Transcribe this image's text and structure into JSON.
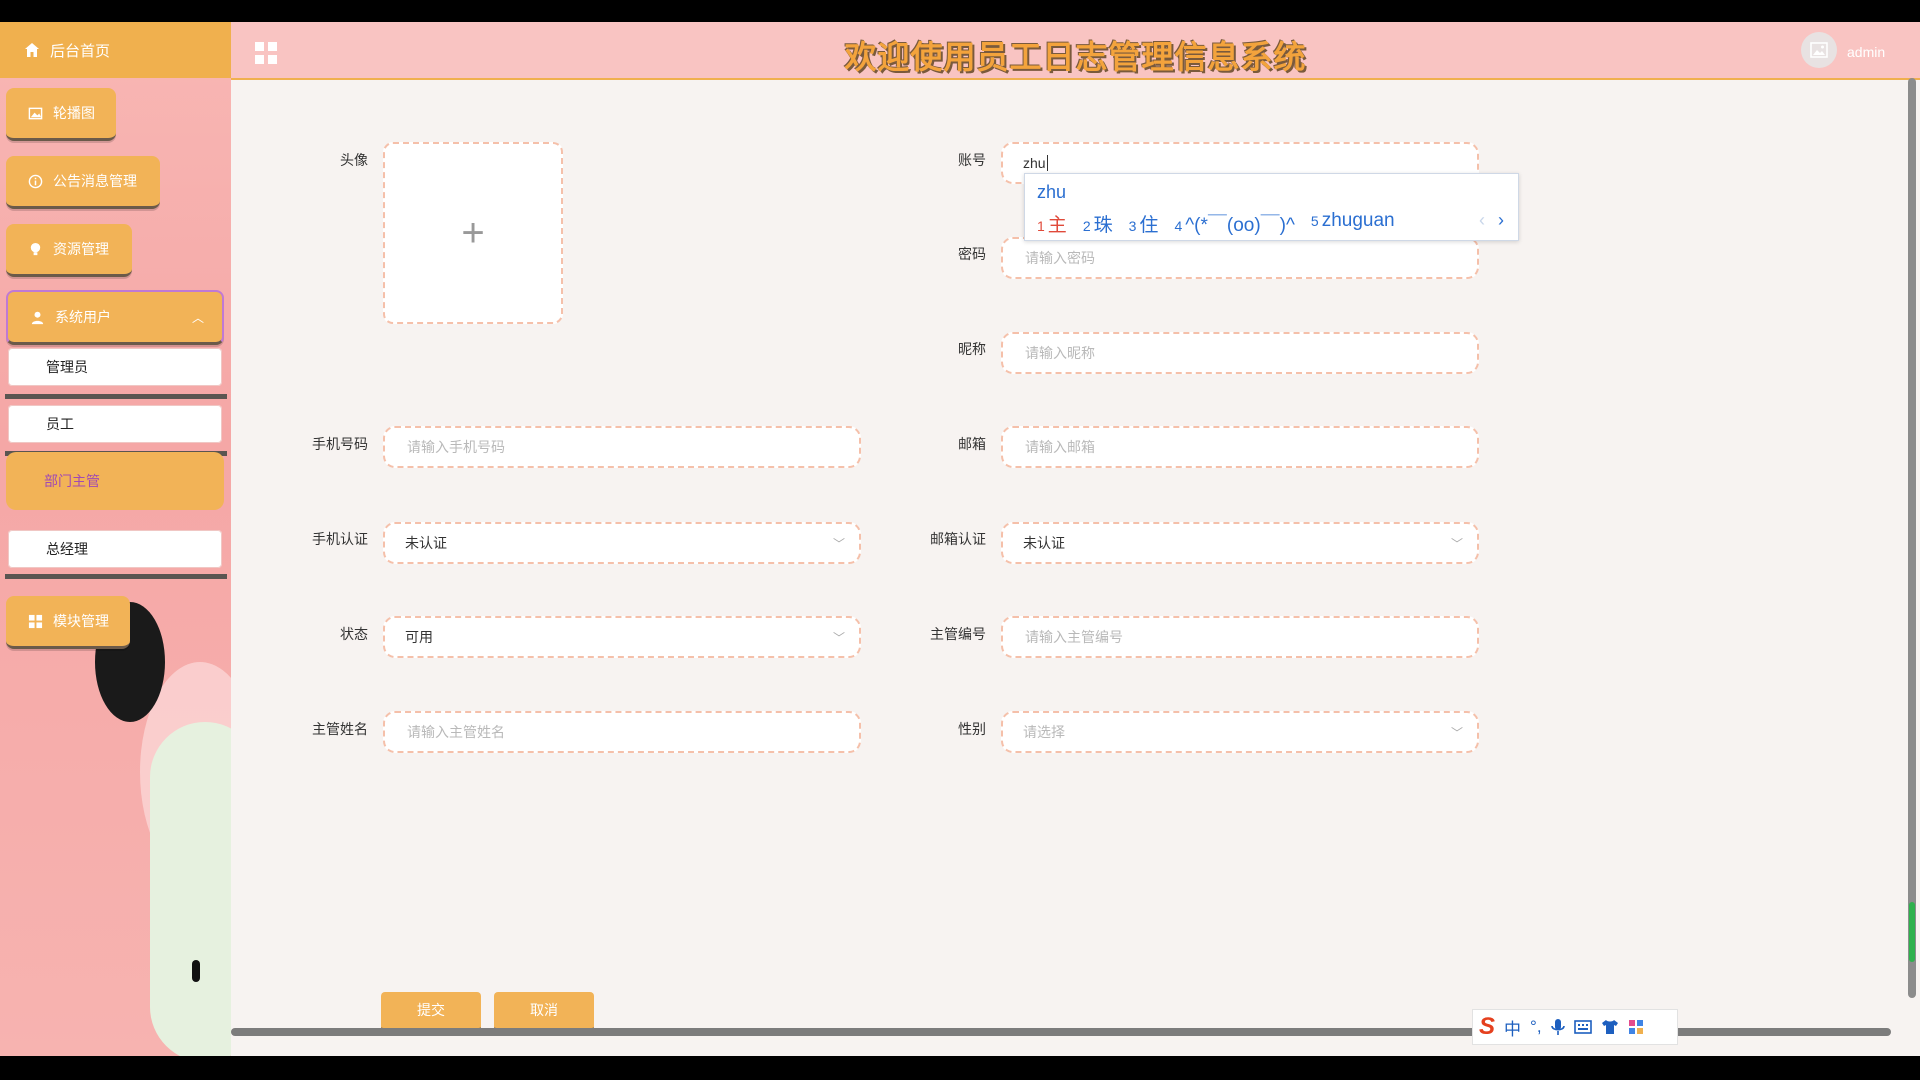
{
  "header": {
    "title": "欢迎使用员工日志管理信息系统",
    "username": "admin"
  },
  "sidebar": {
    "home_label": "后台首页",
    "items": [
      {
        "label": "轮播图"
      },
      {
        "label": "公告消息管理"
      },
      {
        "label": "资源管理"
      },
      {
        "label": "系统用户"
      },
      {
        "label": "模块管理"
      }
    ],
    "sub_items": [
      {
        "label": "管理员"
      },
      {
        "label": "员工"
      },
      {
        "label": "部门主管"
      },
      {
        "label": "总经理"
      }
    ]
  },
  "form": {
    "avatar_label": "头像",
    "account": {
      "label": "账号",
      "value": "zhu"
    },
    "password": {
      "label": "密码",
      "placeholder": "请输入密码"
    },
    "nickname": {
      "label": "昵称",
      "placeholder": "请输入昵称"
    },
    "phone": {
      "label": "手机号码",
      "placeholder": "请输入手机号码"
    },
    "email": {
      "label": "邮箱",
      "placeholder": "请输入邮箱"
    },
    "phone_verify": {
      "label": "手机认证",
      "value": "未认证"
    },
    "email_verify": {
      "label": "邮箱认证",
      "value": "未认证"
    },
    "status": {
      "label": "状态",
      "value": "可用"
    },
    "supervisor_no": {
      "label": "主管编号",
      "placeholder": "请输入主管编号"
    },
    "supervisor_name": {
      "label": "主管姓名",
      "placeholder": "请输入主管姓名"
    },
    "gender": {
      "label": "性别",
      "placeholder": "请选择"
    },
    "submit_label": "提交",
    "cancel_label": "取消"
  },
  "ime": {
    "composition": "zhu",
    "candidates": [
      {
        "num": "1",
        "text": "主"
      },
      {
        "num": "2",
        "text": "珠"
      },
      {
        "num": "3",
        "text": "住"
      },
      {
        "num": "4",
        "text": "^(*￣(oo)￣)^"
      },
      {
        "num": "5",
        "text": "zhuguan"
      }
    ],
    "prev": "‹",
    "next": "›"
  },
  "ime_bar": {
    "logo": "S",
    "lang": "中",
    "punct": "°,"
  },
  "colors": {
    "accent": "#f2b357",
    "sidebar_bg": "#f5a7a6",
    "header_bg": "#f9c4c2",
    "field_border": "#f5c0aa"
  }
}
